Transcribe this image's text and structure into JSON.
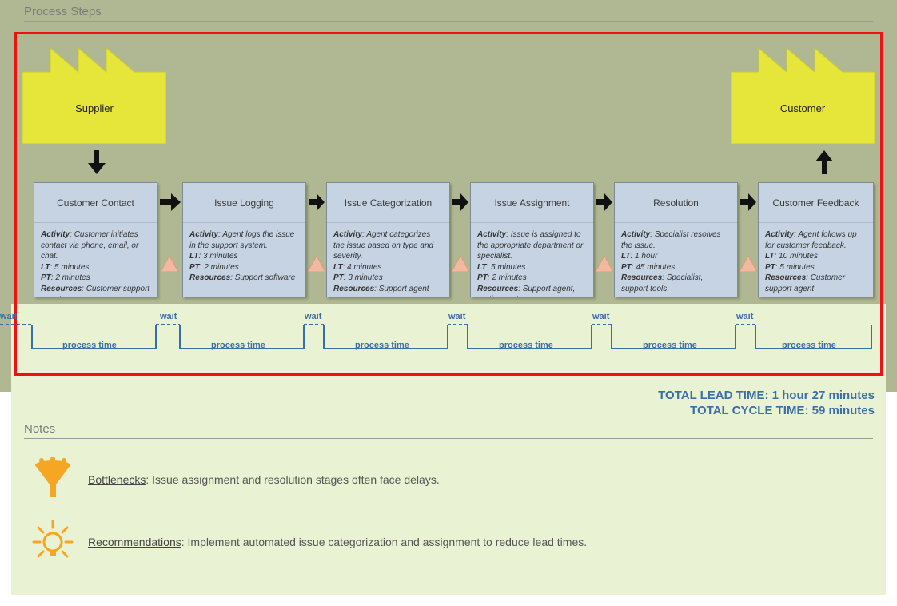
{
  "headings": {
    "process_steps": "Process Steps",
    "notes": "Notes"
  },
  "supplier_label": "Supplier",
  "customer_label": "Customer",
  "steps": [
    {
      "title": "Customer Contact",
      "activity": "Customer initiates contact via phone, email, or chat.",
      "lt": "5 minutes",
      "pt": "2 minutes",
      "resources": "Customer support agent"
    },
    {
      "title": "Issue Logging",
      "activity": "Agent logs the issue in the support system.",
      "lt": "3 minutes",
      "pt": "2 minutes",
      "resources": "Support software"
    },
    {
      "title": "Issue Categorization",
      "activity": "Agent categorizes the issue based on type and severity.",
      "lt": "4 minutes",
      "pt": "3 minutes",
      "resources": "Support agent"
    },
    {
      "title": "Issue Assignment",
      "activity": "Issue is assigned to the appropriate department or specialist.",
      "lt": "5 minutes",
      "pt": "2 minutes",
      "resources": "Support agent, routing system"
    },
    {
      "title": "Resolution",
      "activity": "Specialist resolves the issue.",
      "lt": "1 hour",
      "pt": "45 minutes",
      "resources": "Specialist, support tools"
    },
    {
      "title": "Customer Feedback",
      "activity": "Agent follows up for customer feedback.",
      "lt": "10 minutes",
      "pt": "5 minutes",
      "resources": "Customer support agent"
    }
  ],
  "timeline": {
    "wait": "wait",
    "process_time": "process time"
  },
  "totals": {
    "lead_label": "TOTAL LEAD TIME:",
    "lead_value": "1 hour 27 minutes",
    "cycle_label": "TOTAL CYCLE TIME:",
    "cycle_value": "59 minutes"
  },
  "notes_items": {
    "bottlenecks_label": "Bottlenecks",
    "bottlenecks_text": ": Issue assignment and resolution stages often face delays.",
    "recommendations_label": "Recommendations",
    "recommendations_text": ":  Implement automated issue categorization and assignment to reduce lead times."
  },
  "labels": {
    "activity": "Activity",
    "lt": "LT",
    "pt": "PT",
    "resources": "Resources"
  }
}
